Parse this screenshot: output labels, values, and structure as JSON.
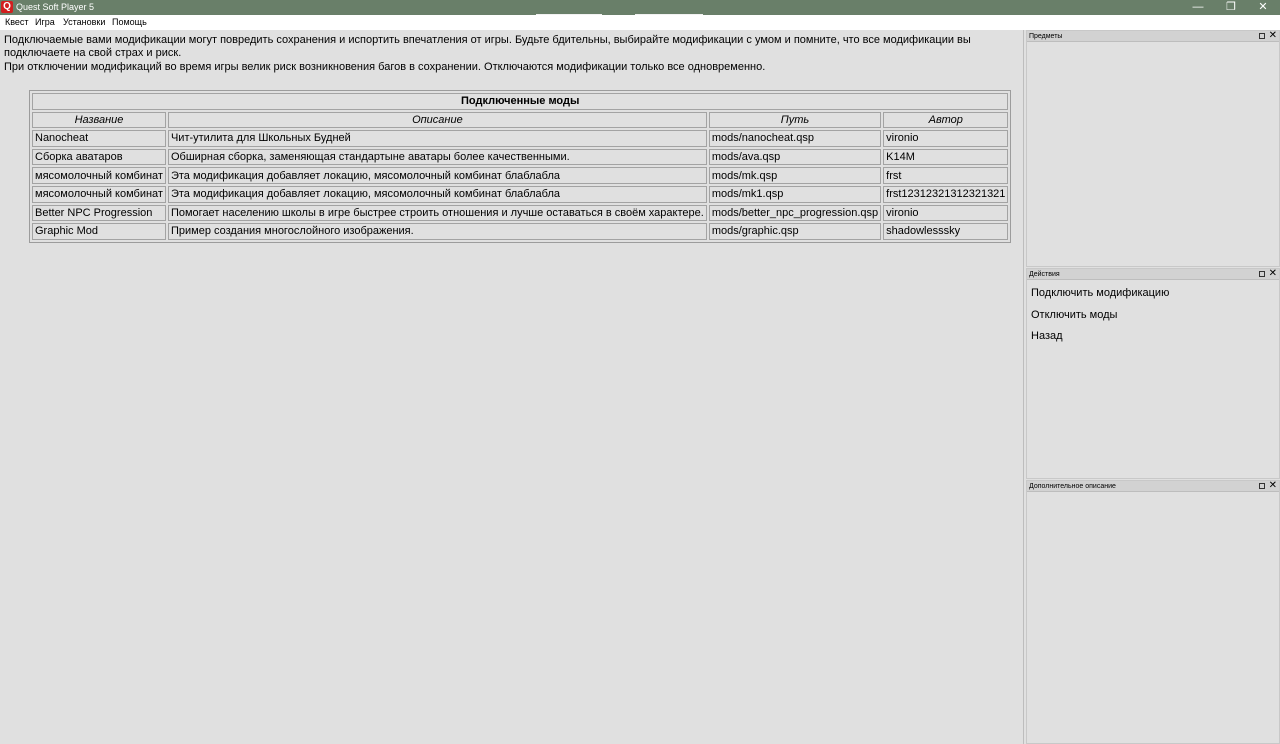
{
  "window": {
    "title": "Quest Soft Player 5",
    "icon_glyph": "Q",
    "minimize_glyph": "—",
    "restore_glyph": "❐",
    "close_glyph": "✕"
  },
  "menu": {
    "items": [
      "Квест",
      "Игра",
      "Установки",
      "Помощь"
    ]
  },
  "main": {
    "intro_lines": [
      "Подключаемые вами модификации могут повредить сохранения и испортить впечатления от игры. Будьте бдительны, выбирайте модификации с умом и помните, что все модификации вы подключаете на свой страх и риск.",
      "При отключении модификаций во время игры велик риск возникновения багов в сохранении. Отключаются модификации только все одновременно."
    ],
    "table": {
      "caption": "Подключенные моды",
      "headers": [
        "Название",
        "Описание",
        "Путь",
        "Автор"
      ],
      "rows": [
        [
          "Nanocheat",
          "Чит-утилита для Школьных Будней",
          "mods/nanocheat.qsp",
          "vironio"
        ],
        [
          "Сборка аватаров",
          "Обширная сборка, заменяющая стандартыне аватары более качественными.",
          "mods/ava.qsp",
          "K14M"
        ],
        [
          "мясомолочный комбинат",
          "Эта модификация добавляет локацию, мясомолочный комбинат блаблабла",
          "mods/mk.qsp",
          "frst"
        ],
        [
          "мясомолочный комбинат",
          "Эта модификация добавляет локацию, мясомолочный комбинат блаблабла",
          "mods/mk1.qsp",
          "frst12312321312321321"
        ],
        [
          "Better NPC Progression",
          "Помогает населению школы в игре быстрее строить отношения и лучше оставаться в своём характере.",
          "mods/better_npc_progression.qsp",
          "vironio"
        ],
        [
          "Graphic Mod",
          "Пример создания многослойного изображения.",
          "mods/graphic.qsp",
          "shadowlesssky"
        ]
      ]
    }
  },
  "panes": {
    "items": {
      "title": "Предметы"
    },
    "actions": {
      "title": "Действия",
      "items": [
        "Подключить модификацию",
        "Отключить моды",
        "Назад"
      ]
    },
    "extra": {
      "title": "Дополнительное описание"
    },
    "float_glyph": "",
    "close_glyph": "✕"
  },
  "colors": {
    "titlebar": "#697f69",
    "background": "#e0e0e0"
  }
}
